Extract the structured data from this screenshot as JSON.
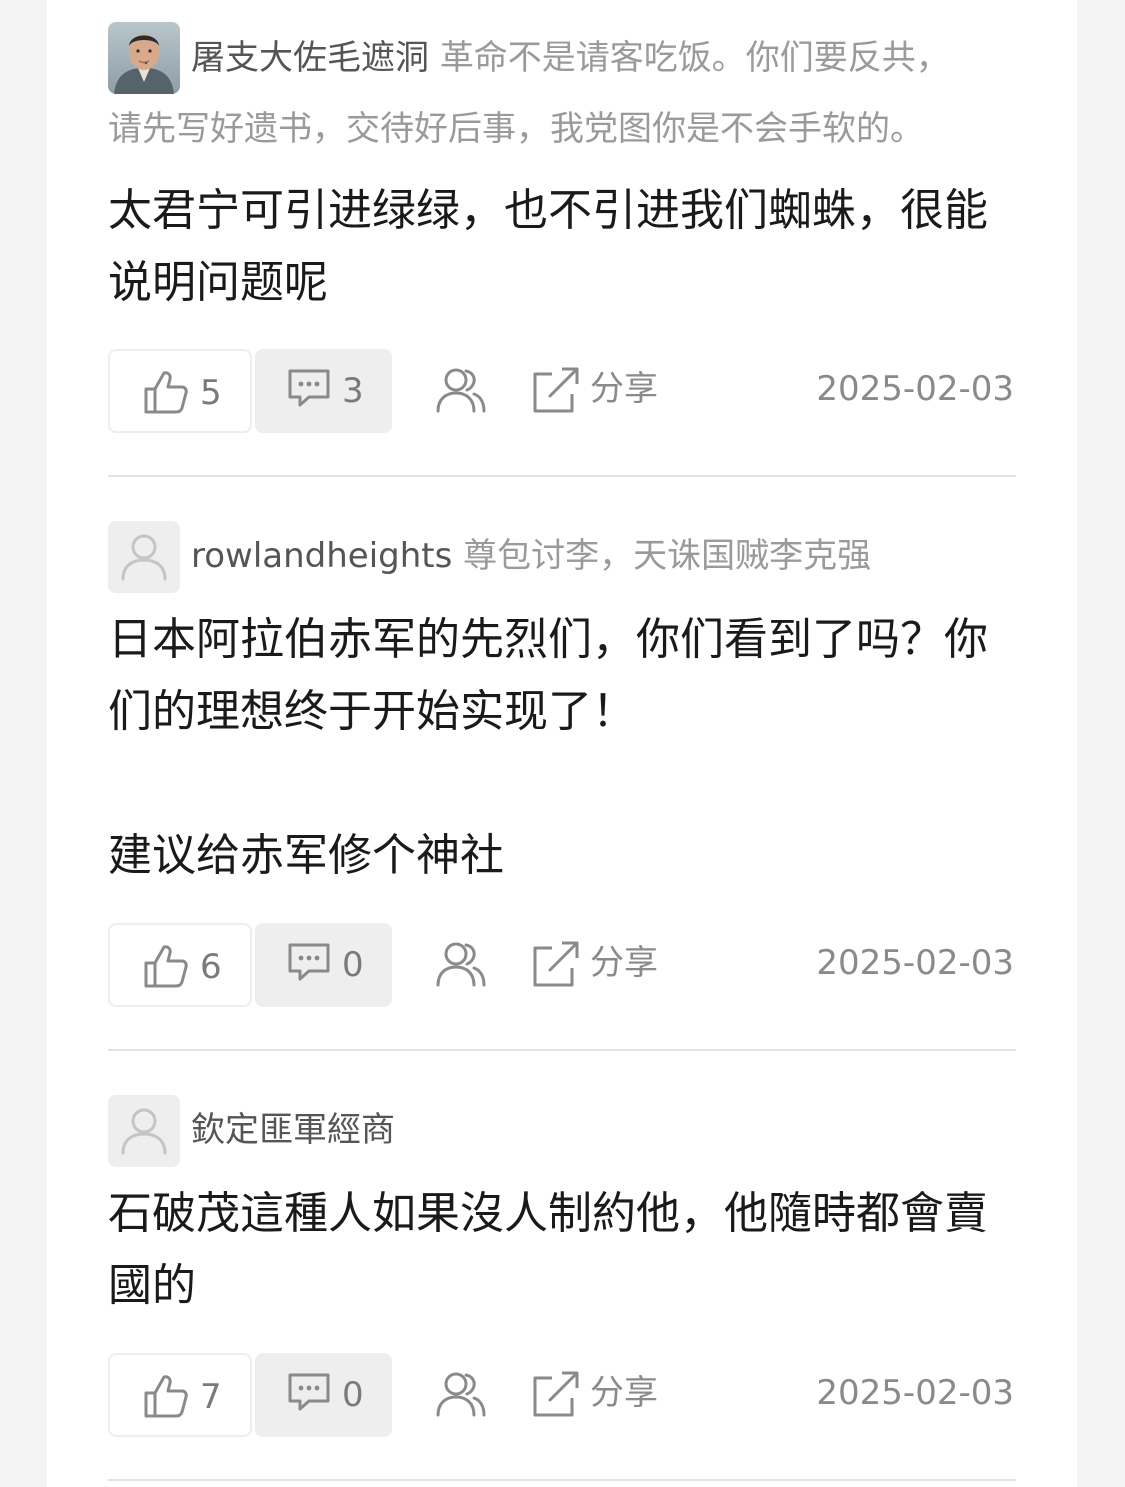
{
  "comments": [
    {
      "username": "屠支大佐毛遮洞",
      "signature_line1": "革命不是请客吃饭。你们要反共，",
      "signature_line2": "请先写好遗书，交待好后事，我党图你是不会手软的。",
      "body": "太君宁可引进绿绿，也不引进我们蜘蛛，很能\n说明问题呢",
      "likes": "5",
      "replies": "3",
      "share_label": "分享",
      "date": "2025-02-03",
      "avatar": "portrait-photo"
    },
    {
      "username": "rowlandheights",
      "signature_line1": "尊包讨李，天诛国贼李克强",
      "signature_line2": "",
      "body": "日本阿拉伯赤军的先烈们，你们看到了吗？你\n们的理想终于开始实现了！\n\n建议给赤军修个神社",
      "likes": "6",
      "replies": "0",
      "share_label": "分享",
      "date": "2025-02-03",
      "avatar": "default-user-icon"
    },
    {
      "username": "欽定匪軍經商",
      "signature_line1": "",
      "signature_line2": "",
      "body": "石破茂這種人如果沒人制約他，他隨時都會賣\n國的",
      "likes": "7",
      "replies": "0",
      "share_label": "分享",
      "date": "2025-02-03",
      "avatar": "default-user-icon"
    }
  ],
  "icons": {
    "like": "thumbs-up-icon",
    "reply": "comment-bubble-icon",
    "users": "users-icon",
    "share": "share-icon"
  },
  "colors": {
    "text_main": "#1a1a1a",
    "text_muted": "#9a9a9a",
    "button_bg": "#eeeeee",
    "divider": "#e2e2e2"
  }
}
